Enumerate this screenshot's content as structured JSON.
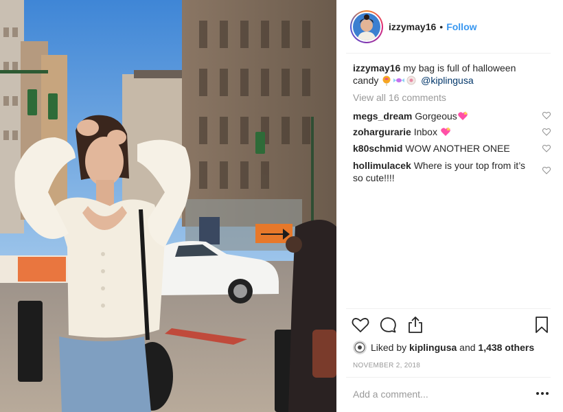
{
  "post": {
    "author": "izzymay16",
    "follow_label": "Follow",
    "separator": "•",
    "caption_user": "izzymay16",
    "caption_text": "my bag is full of halloween candy",
    "caption_mention": "@kiplingusa",
    "caption_emojis": [
      "lollipop-emoji",
      "candy-emoji",
      "candy-emoji-2"
    ],
    "view_all_comments": "View all 16 comments",
    "date": "NOVEMBER 2, 2018",
    "comment_placeholder": "Add a comment..."
  },
  "comments": [
    {
      "user": "megs_dream",
      "text": "Gorgeous",
      "emoji": "sparkling-heart-emoji"
    },
    {
      "user": "zohargurarie",
      "text": "Inbox",
      "emoji": "sparkling-heart-emoji"
    },
    {
      "user": "k80schmid",
      "text": "WOW ANOTHER ONEE",
      "emoji": ""
    },
    {
      "user": "hollimulacek",
      "text": "Where is your top from it’s so cute!!!!",
      "emoji": ""
    }
  ],
  "likes": {
    "prefix": "Liked by",
    "liker": "kiplingusa",
    "joiner": "and",
    "others": "1,438 others"
  },
  "icons": {
    "like": "heart-icon",
    "comment": "comment-bubble-icon",
    "share": "share-icon",
    "save": "bookmark-icon",
    "more": "more-options-icon"
  },
  "colors": {
    "follow": "#3897f0",
    "mention": "#003569",
    "muted": "#999999",
    "text": "#262626",
    "divider": "#efefef",
    "emoji_heart": "#ff4fa7"
  }
}
